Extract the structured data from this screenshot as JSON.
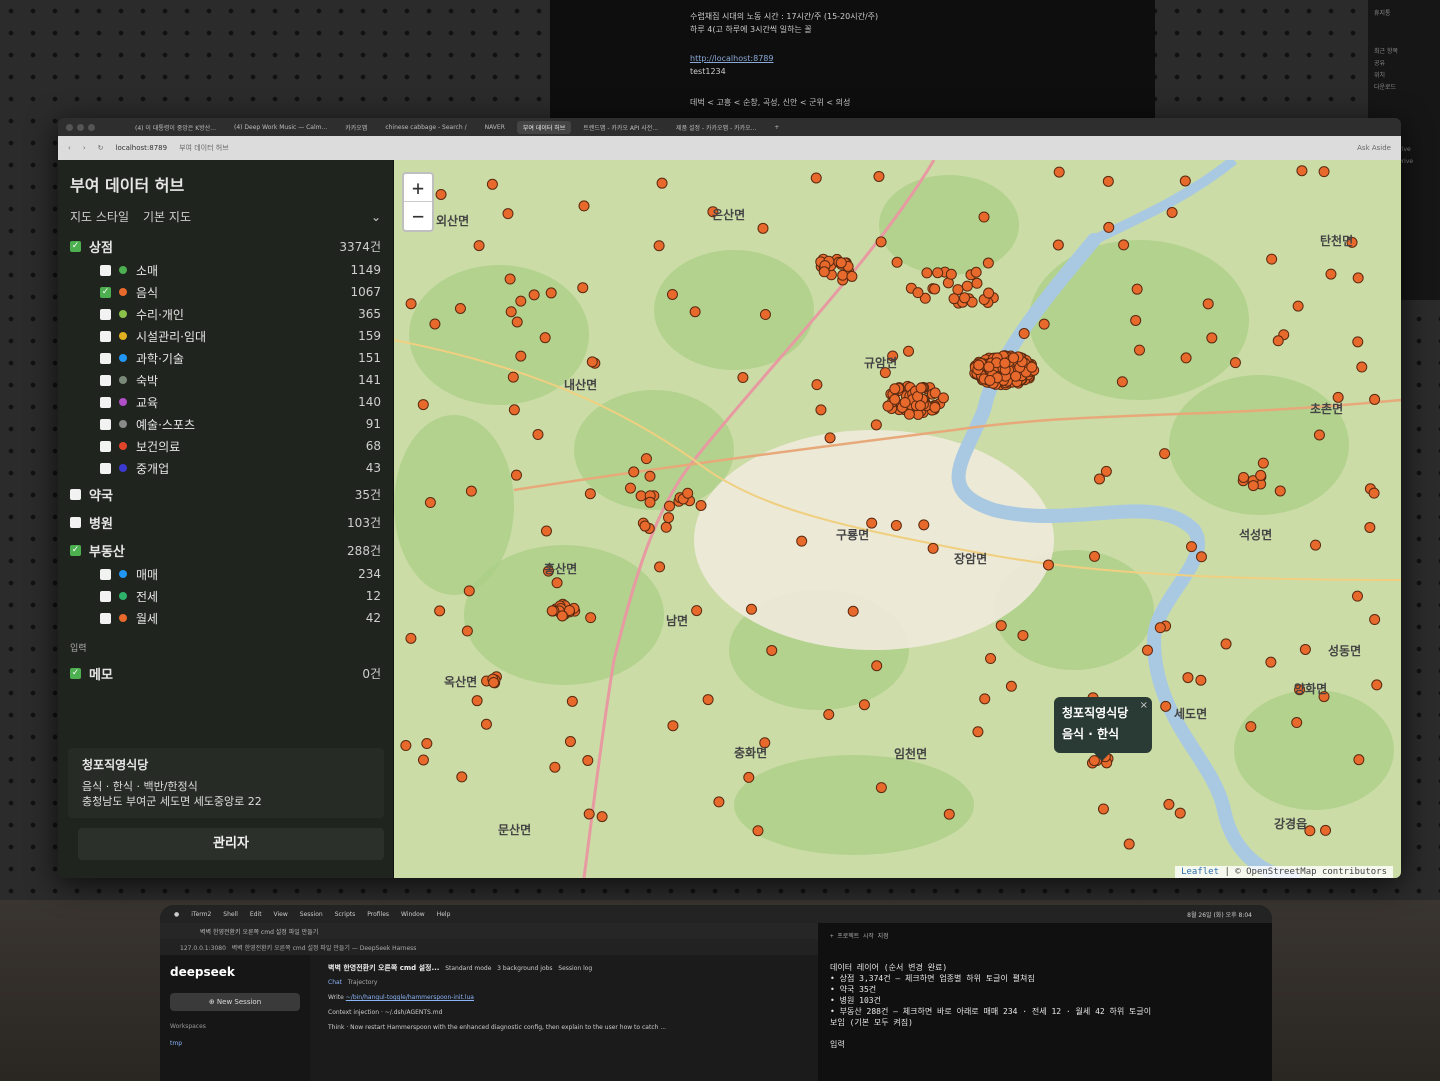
{
  "background_window": {
    "line1": "수렵채집 시대의 노동 시간 : 17시간/주 (15-20시간/주)",
    "line2": "하루 4(고 하루에 3시간씩 일하는 꼴",
    "link": "http://localhost:8789",
    "line3": "test1234",
    "line4": "데벅 < 고흥 < 순창, 곡성, 신안 < 군위 < 의성"
  },
  "side_sliver": [
    "휴지통",
    "최근 항목",
    "공유",
    "위치",
    "다운로드",
    "iCloud Drive",
    "Google Drive"
  ],
  "browser": {
    "tabs": [
      "(4) 이 대통령이 중앙은 K방산...",
      "(4) Deep Work Music — Calm...",
      "카카오맵",
      "chinese cabbage - Search /",
      "NAVER",
      "부여 데이터 허브",
      "트렌드맵 - 카카오 API 사전...",
      "제품 설정 - 카카오맵 - 카카오..."
    ],
    "active_tab": 5,
    "url": "localhost:8789",
    "page_title": "부여 데이터 허브",
    "ask_aside": "Ask Aside"
  },
  "sidebar": {
    "title": "부여 데이터 허브",
    "map_style_label": "지도 스타일",
    "map_style_value": "기본 지도",
    "categories": [
      {
        "label": "상점",
        "count": "3374건",
        "checked": true
      },
      {
        "label": "약국",
        "count": "35건",
        "checked": false
      },
      {
        "label": "병원",
        "count": "103건",
        "checked": false
      },
      {
        "label": "부동산",
        "count": "288건",
        "checked": true
      },
      {
        "label": "메모",
        "count": "0건",
        "checked": true
      }
    ],
    "shop_items": [
      {
        "label": "소매",
        "count": "1149",
        "color": "#4caf50",
        "checked": false
      },
      {
        "label": "음식",
        "count": "1067",
        "color": "#e8692c",
        "checked": true
      },
      {
        "label": "수리·개인",
        "count": "365",
        "color": "#8bc34a",
        "checked": false
      },
      {
        "label": "시설관리·임대",
        "count": "159",
        "color": "#e0b020",
        "checked": false
      },
      {
        "label": "과학·기술",
        "count": "151",
        "color": "#2196f3",
        "checked": false
      },
      {
        "label": "숙박",
        "count": "141",
        "color": "#7a8a7a",
        "checked": false
      },
      {
        "label": "교육",
        "count": "140",
        "color": "#b04fc8",
        "checked": false
      },
      {
        "label": "예술·스포츠",
        "count": "91",
        "color": "#8a8a8a",
        "checked": false
      },
      {
        "label": "보건의료",
        "count": "68",
        "color": "#e0452c",
        "checked": false
      },
      {
        "label": "중개업",
        "count": "43",
        "color": "#3a3ad0",
        "checked": false
      }
    ],
    "realty_items": [
      {
        "label": "매매",
        "count": "234",
        "color": "#2196f3",
        "checked": false
      },
      {
        "label": "전세",
        "count": "12",
        "color": "#2fb36a",
        "checked": false
      },
      {
        "label": "월세",
        "count": "42",
        "color": "#e8692c",
        "checked": false
      }
    ],
    "input_label": "입력",
    "selected_place": {
      "name": "청포직영식당",
      "category": "음식 · 한식 · 백반/한정식",
      "address": "충청남도 부여군 세도면 세도중앙로 22"
    },
    "admin_button": "관리자"
  },
  "map": {
    "zoom_in": "+",
    "zoom_out": "−",
    "popup_title": "청포직영식당",
    "popup_sub": "음식 · 한식",
    "popup_close": "×",
    "attribution_leaflet": "Leaflet",
    "attribution_rest": "| © OpenStreetMap contributors",
    "place_labels": [
      "외산면",
      "은산면",
      "규암면",
      "내산면",
      "구룡면",
      "홍산면",
      "남면",
      "옥산면",
      "충화면",
      "임천면",
      "장암면",
      "석성면",
      "세도면",
      "양화면",
      "탄천면",
      "초촌면",
      "성동면",
      "강경읍",
      "문산면"
    ]
  },
  "laptop": {
    "menubar": [
      "iTerm2",
      "Shell",
      "Edit",
      "View",
      "Session",
      "Scripts",
      "Profiles",
      "Window",
      "Help"
    ],
    "menubar_time": "8월 26일 (화) 오후 8:04",
    "browser_tab": "벽벽 한영전환키 오른쪽 cmd 설정 파일 만들기",
    "browser_url": "127.0.0.1:3080",
    "browser_title": "벽벽 한영전환키 오른쪽 cmd 설정 파일 만들기 — DeepSeek Harness",
    "logo": "deepseek",
    "new_session": "⊕ New Session",
    "workspaces": "Workspaces",
    "tmp": "tmp",
    "chat_header": "벽벽 한영전환키 오른쪽 cmd 설정...",
    "mode": "Standard mode",
    "jobs": "3 background jobs",
    "session_log": "Session log",
    "tab_chat": "Chat",
    "tab_traj": "Trajectory",
    "write_line": "Write",
    "write_path": "~/bin/hangul-toggle/hammerspoon-init.lua",
    "context_line": "Context injection · ~/.dsh/AGENTS.md",
    "think_line": "Think · Now restart Hammerspoon with the enhanced diagnostic config, then explain to the user how to catch ...",
    "terminal_title": "+ 프로젝트 시작 지점",
    "terminal_lines": [
      "데이터 레이어 (순서 변경 완료)",
      "• 상점 3,374건 — 체크하면 업종별 하위 토글이 펼쳐짐",
      "• 약국 35건",
      "• 병원 103건",
      "• 부동산 288건 — 체크하면 바로 아래로 매매 234 · 전세 12 · 월세 42 하위 토글이",
      "  보임 (기본 모두 켜짐)",
      "",
      "입력"
    ]
  }
}
